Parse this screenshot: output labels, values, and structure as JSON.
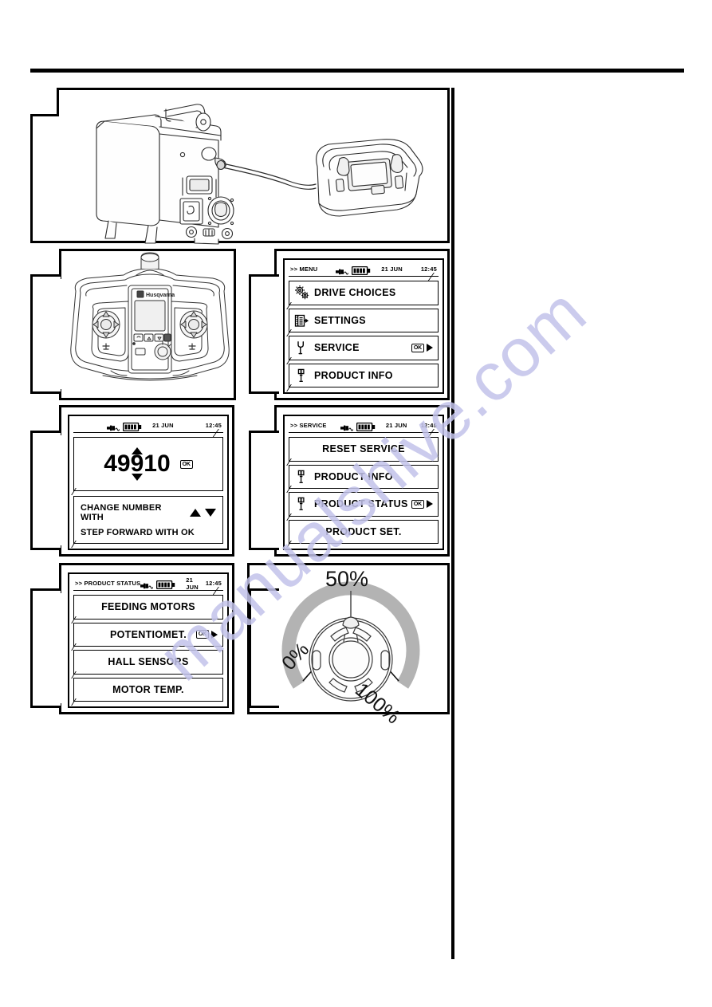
{
  "document": {
    "type": "service-manual-page",
    "watermark": "manualshive.com"
  },
  "figures": [
    {
      "id": "fig-machine-and-remote",
      "name": "machine-with-remote-control",
      "caption": ""
    },
    {
      "id": "fig-remote-control",
      "name": "remote-control-transmitter",
      "brand": "Husqvarna"
    }
  ],
  "screens": {
    "menu": {
      "title": ">> MENU",
      "status": {
        "charge_icon": "plug-icon",
        "battery_icon": "battery-icon",
        "battery_bars": 4,
        "date": "21 JUN",
        "time": "12:45"
      },
      "items": [
        {
          "label": "DRIVE CHOICES",
          "icon": "gears-icon",
          "selected": false,
          "ok": false
        },
        {
          "label": "SETTINGS",
          "icon": "document-arrow-icon",
          "selected": false,
          "ok": false
        },
        {
          "label": "SERVICE",
          "icon": "wrench-icon",
          "selected": true,
          "ok": true,
          "ok_label": "OK"
        },
        {
          "label": "PRODUCT INFO",
          "icon": "info-icon",
          "selected": false,
          "ok": false
        }
      ]
    },
    "service": {
      "title": ">> SERVICE",
      "status": {
        "charge_icon": "plug-icon",
        "battery_icon": "battery-icon",
        "battery_bars": 4,
        "date": "21 JUN",
        "time": "12:45"
      },
      "items": [
        {
          "label": "RESET SERVICE",
          "icon": "",
          "centered": true,
          "ok": false
        },
        {
          "label": "PRODUCT INFO",
          "icon": "info-icon",
          "centered": false,
          "ok": false
        },
        {
          "label": "PRODUCT STATUS",
          "icon": "info-icon",
          "centered": false,
          "ok": true,
          "ok_label": "OK"
        },
        {
          "label": "PRODUCT SET.",
          "icon": "",
          "centered": true,
          "ok": false
        }
      ]
    },
    "product_status": {
      "title": ">> PRODUCT STATUS",
      "status": {
        "charge_icon": "plug-icon",
        "battery_icon": "battery-icon",
        "battery_bars": 4,
        "date": "21 JUN",
        "time": "12:45"
      },
      "items": [
        {
          "label": "FEEDING MOTORS",
          "centered": true,
          "ok": false
        },
        {
          "label": "POTENTIOMET.",
          "centered": true,
          "ok": true,
          "ok_label": "OK"
        },
        {
          "label": "HALL SENSORS",
          "centered": true,
          "ok": false
        },
        {
          "label": "MOTOR TEMP.",
          "centered": true,
          "ok": false
        }
      ]
    },
    "number_entry": {
      "status": {
        "charge_icon": "plug-icon",
        "battery_icon": "battery-icon",
        "battery_bars": 4,
        "date": "21 JUN",
        "time": "12:45"
      },
      "value": "49910",
      "ok_label": "OK",
      "hint_line1": "CHANGE NUMBER WITH",
      "hint_line2": "STEP FORWARD WITH OK"
    }
  },
  "dial": {
    "name": "potentiometer-dial",
    "label_top": "50%",
    "label_left": "0%",
    "label_right": "100%",
    "arc_color": "#b3b3b3",
    "value_percent": 50
  }
}
